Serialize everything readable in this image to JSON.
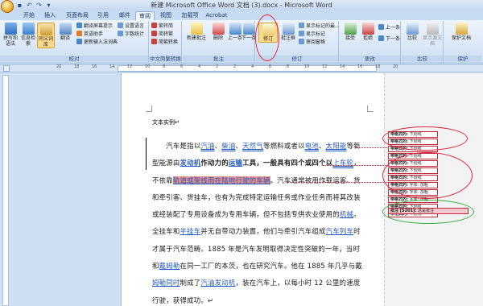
{
  "window": {
    "title": "新建 Microsoft Office Word 文档 (3).docx - Microsoft Word"
  },
  "qat": [
    "save-icon",
    "undo-icon",
    "redo-icon",
    "dropdown-icon"
  ],
  "tabs": [
    {
      "label": "开始"
    },
    {
      "label": "插入"
    },
    {
      "label": "页面布局"
    },
    {
      "label": "引用"
    },
    {
      "label": "邮件"
    },
    {
      "label": "审阅"
    },
    {
      "label": "视图"
    },
    {
      "label": "加载项"
    },
    {
      "label": "Acrobat"
    }
  ],
  "ribbon": {
    "proofing": {
      "label": "校对",
      "spelling": "拼写和语法",
      "research": "信息检索",
      "thesaurus": "同义词库",
      "translate": "翻译",
      "translate_tip": "翻译屏幕提示",
      "english_assist": "英语助手",
      "update_ime": "更新输入法词典",
      "set_language": "设置语言",
      "word_count": "字数统计"
    },
    "chinese": {
      "label": "中文简繁转换",
      "to_trad": "繁转简",
      "to_simp": "简转繁",
      "convert": "简繁转换"
    },
    "comments": {
      "label": "批注",
      "new": "新建批注",
      "delete": "删除",
      "prev": "上一条",
      "next": "下一条"
    },
    "tracking": {
      "label": "修订",
      "track": "修订",
      "balloons": "批注框",
      "display_mode": "显示标记的最...",
      "show_markup": "显示标记",
      "reviewing_pane": "审阅窗格"
    },
    "changes": {
      "label": "更改",
      "accept": "接受",
      "reject": "拒绝",
      "prev": "上一条",
      "next": "下一条"
    },
    "compare": {
      "label": "比较",
      "compare": "比较",
      "show_source": "显示源文档"
    },
    "protect": {
      "label": "保护",
      "protect_doc": "保护文档"
    }
  },
  "ruler_numbers": [
    "20",
    "18",
    "16",
    "14",
    "12",
    "10",
    "8",
    "6",
    "4",
    "2",
    "2",
    "4",
    "6",
    "8",
    "10",
    "12",
    "14",
    "16",
    "18",
    "20"
  ],
  "document": {
    "heading": "文本实例",
    "lines": [
      [
        "汽车是指以",
        "汽油",
        "、",
        "柴油",
        "、",
        "天然气",
        "等燃料或者以",
        "电池",
        "、",
        "太阳能",
        "等新"
      ],
      [
        "型能源由",
        "发动机",
        "作动力的",
        "运输",
        "工具，一般具有四个或四个以",
        "上车轮",
        "，"
      ],
      [
        "不依靠",
        "轨道或架线而在陆地行驶的车辆",
        "。汽车通常被用作载运客、货"
      ],
      [
        "和牵引客、货挂车，也有为完成特定运输任务或作业任务而将其改装"
      ],
      [
        "或经装配了专用设备成为专用车辆，但不包括专供农业使用的",
        "机械",
        "。"
      ],
      [
        "全挂车和",
        "半挂车",
        "并无自带动力装置，他们与牵引汽车组成",
        "汽车列车",
        "时"
      ],
      [
        "才属于汽车范畴。1885 年是汽车发明取得决定性突破的一年，当时"
      ],
      [
        "和",
        "戴姆勒",
        "在同一工厂的本茨，也在研究汽车。他在 1885 年几乎与戴"
      ],
      [
        "姆勒同时",
        "制成了",
        "汽油发动机",
        "，装在汽车上，以每小时 12 公里的速度"
      ],
      [
        "行驶，获得成功。"
      ]
    ]
  },
  "balloons": [
    {
      "label": "带格式的:",
      "value": "下划线"
    },
    {
      "label": "带格式的:",
      "value": "下划线"
    },
    {
      "label": "带格式的:",
      "value": "下划线"
    },
    {
      "label": "带格式的:",
      "value": "下划线"
    },
    {
      "label": "带格式的:",
      "value": "下划线"
    },
    {
      "label": "带格式的:",
      "value": "下划线"
    },
    {
      "label": "带格式的:",
      "value": "下划线"
    },
    {
      "label": "带格式的:",
      "value": "字体: 加粗"
    },
    {
      "label": "带格式的:",
      "value": "字体: 加粗"
    },
    {
      "label": "带格式的:",
      "value": "字体: 加粗"
    },
    {
      "label": "带格式的:",
      "value": "下划线"
    },
    {
      "label": "带格式的:",
      "value": "下划线"
    }
  ],
  "comment": {
    "label": "批注 [S201]:",
    "value": "这是批注"
  },
  "colors": {
    "insertion": "#2159c3",
    "balloon_border": "#c0293a",
    "annotation_red": "#e2263b",
    "annotation_green": "#35b040"
  }
}
